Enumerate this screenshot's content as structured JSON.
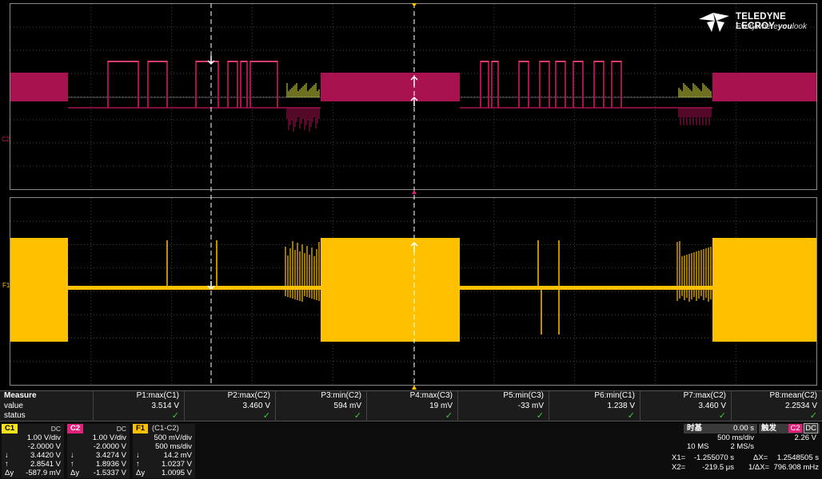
{
  "logo": {
    "brand": "TELEDYNE LECROY",
    "tagline_pre": "Everywhere",
    "tagline_bold": "you",
    "tagline_post": "look"
  },
  "markers": {
    "c2": "C2",
    "f1": "F1"
  },
  "colors": {
    "c1": "#f5e21a",
    "c2": "#e0227a",
    "f1": "#ffc000",
    "c2_wave": "#a8124f",
    "ok": "#3ccf3c"
  },
  "measure": {
    "labels": [
      "Measure",
      "value",
      "status"
    ],
    "params": [
      {
        "name": "P1:max(C1)",
        "value": "3.514 V",
        "status": "✓"
      },
      {
        "name": "P2:max(C2)",
        "value": "3.460 V",
        "status": "✓"
      },
      {
        "name": "P3:min(C2)",
        "value": "594 mV",
        "status": "✓"
      },
      {
        "name": "P4:max(C3)",
        "value": "19 mV",
        "status": "✓"
      },
      {
        "name": "P5:min(C3)",
        "value": "-33 mV",
        "status": "✓"
      },
      {
        "name": "P6:min(C1)",
        "value": "1.238 V",
        "status": "✓"
      },
      {
        "name": "P7:max(C2)",
        "value": "3.460 V",
        "status": "✓"
      },
      {
        "name": "P8:mean(C2)",
        "value": "2.2534 V",
        "status": "✓"
      }
    ]
  },
  "channels": {
    "c1": {
      "tag": "C1",
      "coupling": "DC",
      "rows": [
        {
          "sym": "",
          "val": "1.00 V/div"
        },
        {
          "sym": "",
          "val": "-2.0000 V"
        },
        {
          "sym": "↓",
          "val": "3.4420 V"
        },
        {
          "sym": "↑",
          "val": "2.8541 V"
        },
        {
          "sym": "Δy",
          "val": "-587.9 mV"
        }
      ]
    },
    "c2": {
      "tag": "C2",
      "coupling": "DC",
      "rows": [
        {
          "sym": "",
          "val": "1.00 V/div"
        },
        {
          "sym": "",
          "val": "-2.0000 V"
        },
        {
          "sym": "↓",
          "val": "3.4274 V"
        },
        {
          "sym": "↑",
          "val": "1.8936 V"
        },
        {
          "sym": "Δy",
          "val": "-1.5337 V"
        }
      ]
    },
    "f1": {
      "tag": "F1",
      "formula": "(C1-C2)",
      "rows": [
        {
          "sym": "",
          "val": "500 mV/div"
        },
        {
          "sym": "",
          "val": "500 ms/div"
        },
        {
          "sym": "↓",
          "val": "14.2 mV"
        },
        {
          "sym": "↑",
          "val": "1.0237 V"
        },
        {
          "sym": "Δy",
          "val": "1.0095 V"
        }
      ]
    }
  },
  "timebase": {
    "label": "时基",
    "delay": "0.00 s",
    "per_div": "500 ms/div",
    "samples": "10 MS",
    "rate": "2 MS/s",
    "x1_label": "X1=",
    "x1": "-1.255070 s",
    "x2_label": "X2=",
    "x2": "-219.5 μs",
    "dx_label": "ΔX=",
    "dx": "1.2548505 s",
    "inv_label": "1/ΔX=",
    "inv": "796.908 mHz"
  },
  "trigger": {
    "label": "触发",
    "source": "C2",
    "coupling": "DC",
    "level": "2.26 V"
  }
}
